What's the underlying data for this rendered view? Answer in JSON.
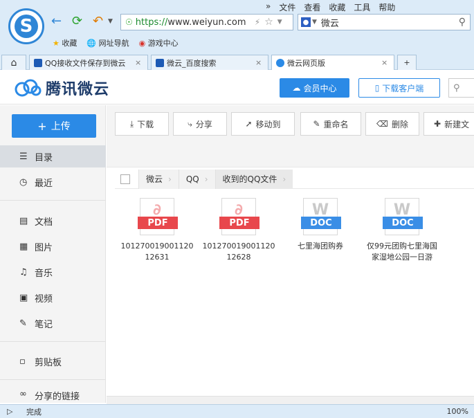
{
  "browser": {
    "menu": [
      "»",
      "文件",
      "查看",
      "收藏",
      "工具",
      "帮助"
    ],
    "url_scheme": "https://",
    "url_host": "www.weiyun.com",
    "search_value": "微云",
    "favorites": [
      "收藏",
      "网址导航",
      "游戏中心"
    ],
    "tabs": [
      {
        "label": "QQ接收文件保存到微云"
      },
      {
        "label": "微云_百度搜索"
      },
      {
        "label": "微云网页版"
      }
    ],
    "status_text": "完成",
    "zoom": "100%"
  },
  "header": {
    "brand": "腾讯微云",
    "vip_label": "会员中心",
    "client_label": "下载客户端"
  },
  "sidebar": {
    "upload_label": "上传",
    "items": [
      {
        "label": "目录"
      },
      {
        "label": "最近"
      },
      {
        "label": "文档"
      },
      {
        "label": "图片"
      },
      {
        "label": "音乐"
      },
      {
        "label": "视频"
      },
      {
        "label": "笔记"
      },
      {
        "label": "剪贴板"
      },
      {
        "label": "分享的链接"
      }
    ]
  },
  "toolbar": {
    "download": "下载",
    "share": "分享",
    "move": "移动到",
    "rename": "重命名",
    "delete": "删除",
    "new_folder": "新建文"
  },
  "breadcrumb": [
    "微云",
    "QQ",
    "收到的QQ文件"
  ],
  "files": [
    {
      "type": "PDF",
      "name": "10127001900112012631"
    },
    {
      "type": "PDF",
      "name": "10127001900112012628"
    },
    {
      "type": "DOC",
      "name": "七里海团购券"
    },
    {
      "type": "DOC",
      "name": "仅99元团购七里海国家湿地公园一日游"
    }
  ]
}
